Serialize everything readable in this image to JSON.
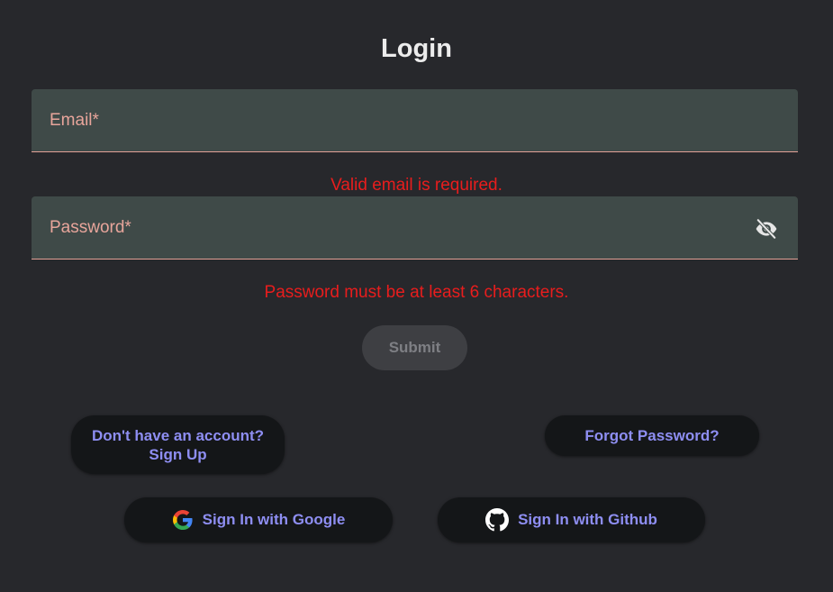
{
  "form": {
    "title": "Login",
    "email": {
      "label": "Email*",
      "value": "",
      "error": "Valid email is required."
    },
    "password": {
      "label": "Password*",
      "value": "",
      "error": "Password must be at least 6 characters."
    },
    "submit_label": "Submit"
  },
  "links": {
    "signup_line1": "Don't have an account?",
    "signup_line2": "Sign Up",
    "forgot_password": "Forgot Password?"
  },
  "oauth": {
    "google_label": "Sign In with Google",
    "github_label": "Sign In with Github"
  },
  "icons": {
    "password_toggle": "eye-off-icon",
    "google": "google-logo-icon",
    "github": "github-logo-icon"
  },
  "colors": {
    "background": "#27282c",
    "field_background": "#3f4a48",
    "label": "#e8a59b",
    "error": "#e81d1d",
    "link": "#8e8ef2",
    "button_dark": "#141618"
  }
}
